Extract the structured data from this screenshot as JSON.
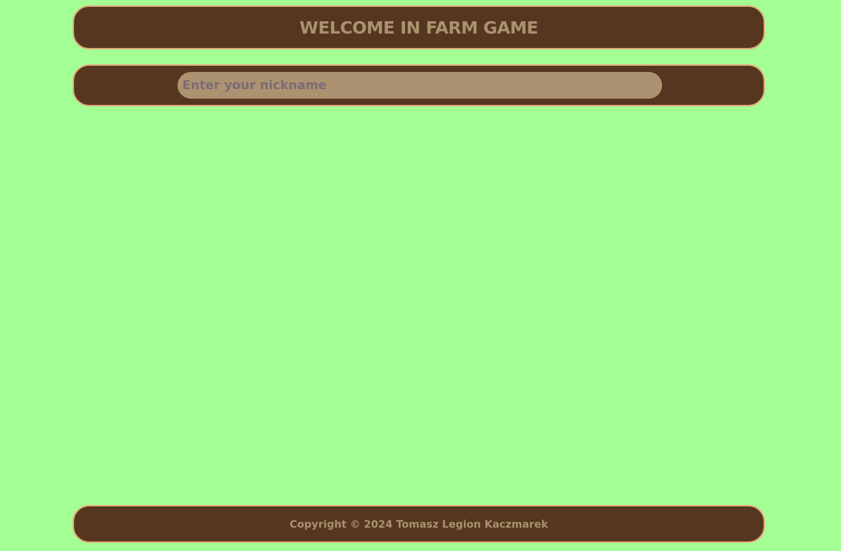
{
  "header": {
    "title": "WELCOME IN FARM GAME"
  },
  "nickname": {
    "value": "",
    "placeholder": "Enter your nickname"
  },
  "footer": {
    "copyright": "Copyright © 2024 Tomasz Legion Kaczmarek"
  },
  "colors": {
    "background": "#a3ff93",
    "panel": "#54371e",
    "panel_border": "#e8a37a",
    "text": "#aa916f",
    "input_background": "#ad9271"
  }
}
